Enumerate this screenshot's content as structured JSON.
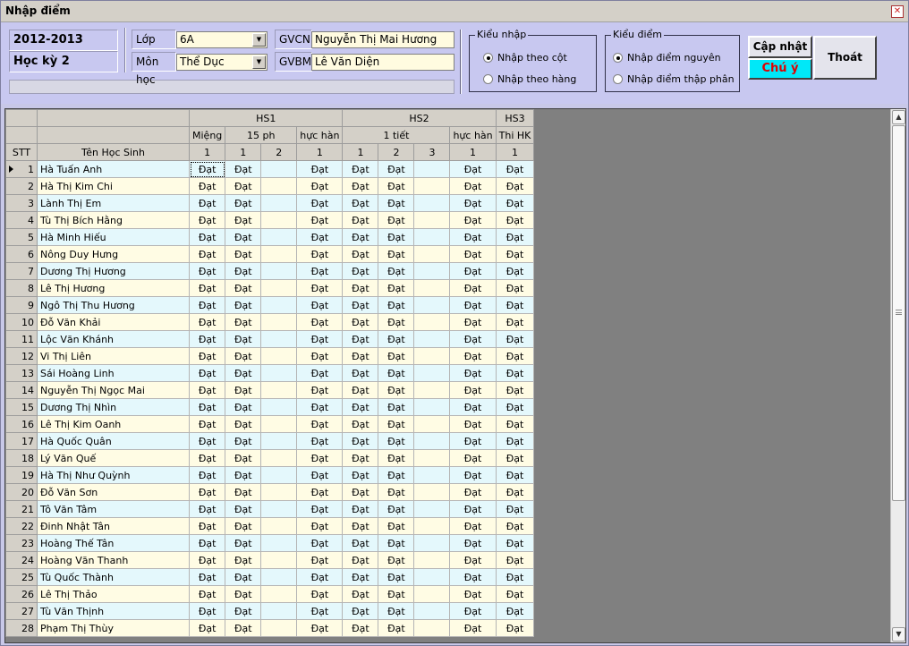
{
  "window": {
    "title": "Nhập điểm"
  },
  "info": {
    "school_year": "2012-2013",
    "semester": "Học kỳ 2"
  },
  "form": {
    "class_label": "Lớp",
    "class_value": "6A",
    "subject_label": "Môn học",
    "subject_value": "Thể Dục",
    "homeroom_label": "GVCN",
    "homeroom_value": "Nguyễn Thị Mai Hương",
    "subject_teacher_label": "GVBM",
    "subject_teacher_value": "Lê Văn Diện"
  },
  "input_mode": {
    "title": "Kiểu nhập",
    "options": [
      "Nhập theo cột",
      "Nhập theo hàng"
    ],
    "selected": 0
  },
  "score_type": {
    "title": "Kiểu điểm",
    "options": [
      "Nhập điểm nguyên",
      "Nhập điểm thập phân"
    ],
    "selected": 0
  },
  "buttons": {
    "update": "Cập nhật",
    "note": "Chú ý",
    "exit": "Thoát"
  },
  "grid": {
    "group_headers": [
      "HS1",
      "HS2",
      "HS3"
    ],
    "sub_headers": [
      "Miệng",
      "15 ph",
      "hực hàn",
      "1 tiết",
      "hực hàn",
      "Thi HK"
    ],
    "col_numbers": [
      "1",
      "1",
      "2",
      "1",
      "1",
      "2",
      "3",
      "1",
      "1"
    ],
    "stt_header": "STT",
    "name_header": "Tên Học Sinh",
    "pass_text": "Đạt",
    "students": [
      "Hà Tuấn Anh",
      "Hà Thị Kim Chi",
      "Lành Thị Em",
      "Tù Thị Bích Hằng",
      "Hà Minh Hiếu",
      "Nông Duy Hưng",
      "Dương Thị Hương",
      "Lê Thị Hương",
      "Ngô Thị Thu Hương",
      "Đỗ Văn Khải",
      "Lộc Văn Khánh",
      "Vi Thị Liên",
      "Sái Hoàng Linh",
      "Nguyễn Thị Ngọc Mai",
      "Dương Thị Nhìn",
      "Lê Thị Kim Oanh",
      "Hà Quốc Quân",
      "Lý Văn Quế",
      "Hà Thị Như Quỳnh",
      "Đỗ Văn Sơn",
      "Tô Văn Tâm",
      "Đinh Nhật Tân",
      "Hoàng Thế Tân",
      "Hoàng Văn Thanh",
      "Tù Quốc Thành",
      "Lê Thị Thảo",
      "Tù Văn Thịnh",
      "Phạm Thị Thùy"
    ]
  }
}
